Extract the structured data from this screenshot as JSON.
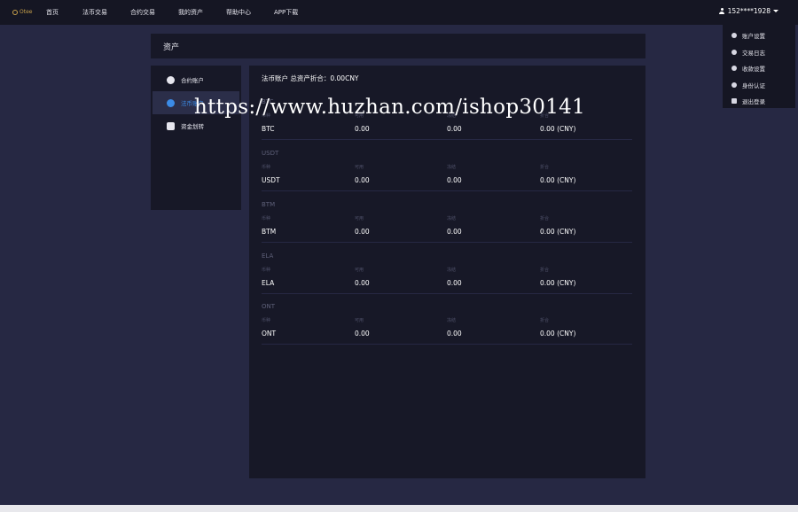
{
  "header": {
    "logo_text": "Otee",
    "nav": [
      "首页",
      "法币交易",
      "合约交易",
      "我的资产",
      "帮助中心",
      "APP下载"
    ],
    "user_label": "152****1928"
  },
  "user_dropdown": {
    "items": [
      "账户设置",
      "交易日志",
      "收款设置",
      "身份认证",
      "退出登录"
    ]
  },
  "page": {
    "title": "资产"
  },
  "sidebar": {
    "items": [
      {
        "label": "合约账户",
        "active": false
      },
      {
        "label": "法币账户",
        "active": true
      },
      {
        "label": "资金划转",
        "active": false
      }
    ]
  },
  "main": {
    "summary": "法币账户 总资产折合：0.00CNY",
    "column_headers": [
      "币种",
      "可用",
      "冻结",
      "折合"
    ],
    "assets": [
      {
        "name": "BTC",
        "currency": "BTC",
        "available": "0.00",
        "frozen": "0.00",
        "equivalent": "0.00 (CNY)"
      },
      {
        "name": "USDT",
        "currency": "USDT",
        "available": "0.00",
        "frozen": "0.00",
        "equivalent": "0.00 (CNY)"
      },
      {
        "name": "BTM",
        "currency": "BTM",
        "available": "0.00",
        "frozen": "0.00",
        "equivalent": "0.00 (CNY)"
      },
      {
        "name": "ELA",
        "currency": "ELA",
        "available": "0.00",
        "frozen": "0.00",
        "equivalent": "0.00 (CNY)"
      },
      {
        "name": "ONT",
        "currency": "ONT",
        "available": "0.00",
        "frozen": "0.00",
        "equivalent": "0.00 (CNY)"
      }
    ]
  },
  "watermark": "https://www.huzhan.com/ishop30141",
  "colors": {
    "background": "#262843",
    "panel": "#171827",
    "topbar": "#151623",
    "active_accent": "#3b8be6"
  }
}
